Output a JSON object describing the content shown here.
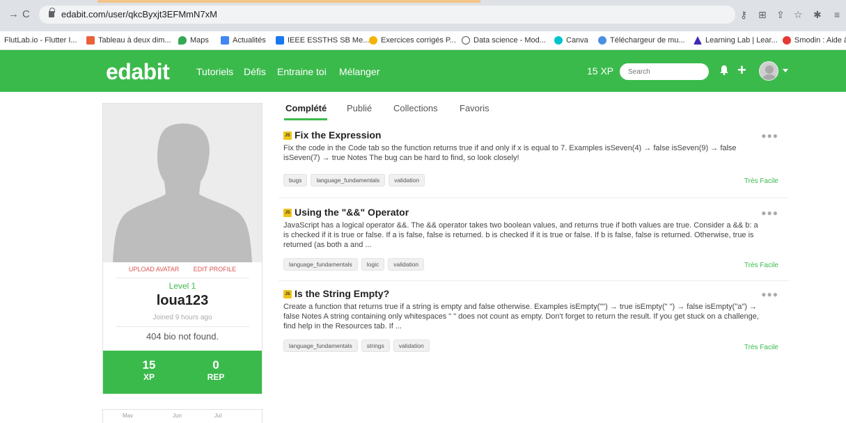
{
  "browser": {
    "url": "edabit.com/user/qkcByxjt3EFMmN7xM",
    "bookmarks": [
      {
        "label": "FlutLab.io - Flutter I...",
        "color": "#ffffff"
      },
      {
        "label": "Tableau à deux dim...",
        "color": "#e8613a"
      },
      {
        "label": "Maps",
        "color": "#34a853"
      },
      {
        "label": "Actualités",
        "color": "#4285f4"
      },
      {
        "label": "IEEE ESSTHS SB Me...",
        "color": "#1877f2"
      },
      {
        "label": "Exercices corrigés P...",
        "color": "#f4b400"
      },
      {
        "label": "Data science - Mod...",
        "color": "#ffffff"
      },
      {
        "label": "Canva",
        "color": "#00c4cc"
      },
      {
        "label": "Téléchargeur de mu...",
        "color": "#4a90e2"
      },
      {
        "label": "Learning Lab | Lear...",
        "color": "#3d2bb5"
      },
      {
        "label": "Smodin : Aide à",
        "color": "#e53935"
      }
    ]
  },
  "header": {
    "logo": "edabit",
    "nav": [
      "Tutoriels",
      "Défis",
      "Entraine toi",
      "Mélanger"
    ],
    "xp": "15 XP",
    "search_placeholder": "Search",
    "accent_color": "#3bba4c"
  },
  "profile": {
    "upload_avatar": "UPLOAD AVATAR",
    "edit_profile": "EDIT PROFILE",
    "level": "Level 1",
    "username": "loua123",
    "joined": "Joined 9 hours ago",
    "bio": "404 bio not found.",
    "xp_value": "15",
    "xp_label": "XP",
    "rep_value": "0",
    "rep_label": "REP",
    "mini": [
      "Mav",
      "Jun",
      "Jul"
    ]
  },
  "tabs": [
    "Complété",
    "Publié",
    "Collections",
    "Favoris"
  ],
  "challenges": [
    {
      "lang": "JS",
      "title": "Fix the Expression",
      "description": "Fix the code in the Code tab so the function returns true if and only if x is equal to 7. Examples isSeven(4) → false isSeven(9) → false isSeven(7) → true Notes The bug can be hard to find, so look closely!",
      "tags": [
        "bugs",
        "language_fundamentals",
        "validation"
      ],
      "difficulty": "Très Facile"
    },
    {
      "lang": "JS",
      "title": "Using the \"&&\" Operator",
      "description": "JavaScript has a logical operator &&. The && operator takes two boolean values, and returns true if both values are true. Consider a && b: a is checked if it is true or false. If a is false, false is returned. b is checked if it is true or false. If b is false, false is returned. Otherwise, true is returned (as both a and ...",
      "tags": [
        "language_fundamentals",
        "logic",
        "validation"
      ],
      "difficulty": "Très Facile"
    },
    {
      "lang": "JS",
      "title": "Is the String Empty?",
      "description": "Create a function that returns true if a string is empty and false otherwise. Examples isEmpty(\"\") → true isEmpty(\" \") → false isEmpty(\"a\") → false Notes A string containing only whitespaces \" \" does not count as empty. Don't forget to return the result. If you get stuck on a challenge, find help in the Resources tab. If ...",
      "tags": [
        "language_fundamentals",
        "strings",
        "validation"
      ],
      "difficulty": "Très Facile"
    }
  ]
}
